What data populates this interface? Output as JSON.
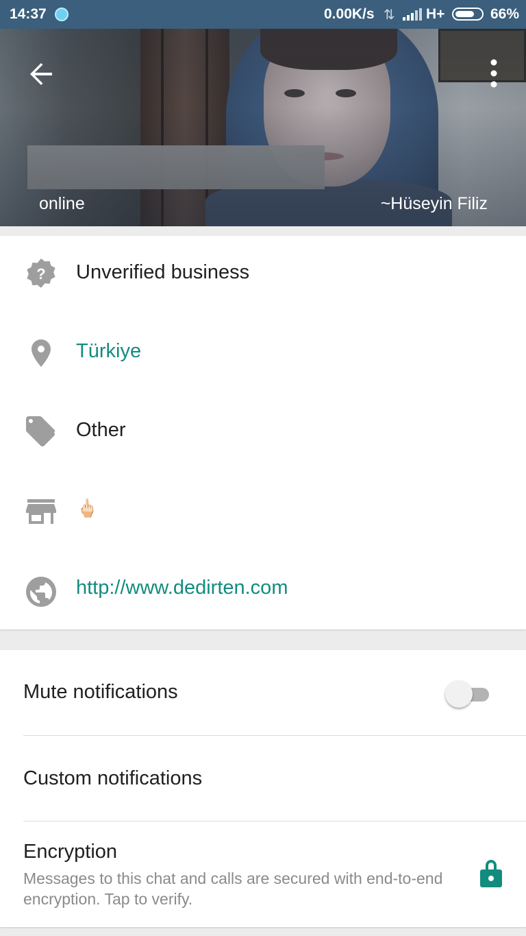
{
  "status_bar": {
    "time": "14:37",
    "net_speed": "0.00K/s",
    "network_type": "H+",
    "battery_percent": "66%",
    "battery_level": 0.66
  },
  "header": {
    "status": "online",
    "push_name": "~Hüseyin Filiz",
    "back_icon": "arrow-back-icon",
    "menu_icon": "more-vert-icon"
  },
  "business": {
    "verification": "Unverified business",
    "location": "Türkiye",
    "category": "Other",
    "description": "🖕🏻",
    "website": "http://www.dedirten.com"
  },
  "settings": {
    "mute_label": "Mute notifications",
    "mute_on": false,
    "custom_label": "Custom notifications",
    "encryption_label": "Encryption",
    "encryption_desc": "Messages to this chat and calls are secured with end-to-end encryption. Tap to verify."
  },
  "colors": {
    "accent": "#128c7e",
    "status_bar": "#3b5f7c",
    "icon_gray": "#9e9e9e"
  }
}
